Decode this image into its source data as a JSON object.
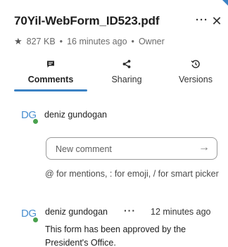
{
  "file": {
    "title": "70Yil-WebForm_ID523.pdf",
    "size": "827 KB",
    "modified": "16 minutes ago",
    "role": "Owner",
    "more_icon": "ellipsis-icon",
    "close_icon": "close-icon",
    "favorite_icon": "star-icon"
  },
  "tabs": [
    {
      "label": "Comments",
      "icon": "comment-icon",
      "active": true
    },
    {
      "label": "Sharing",
      "icon": "share-icon",
      "active": false
    },
    {
      "label": "Versions",
      "icon": "history-icon",
      "active": false
    }
  ],
  "current_user": {
    "initials": "DG",
    "name": "deniz gundogan"
  },
  "new_comment": {
    "placeholder": "New comment",
    "hint": "@ for mentions, : for emoji, / for smart picker",
    "submit_icon": "arrow-right-icon"
  },
  "comments": [
    {
      "initials": "DG",
      "author": "deniz gundogan",
      "time": "12 minutes ago",
      "text": "This form has been approved by the President's Office."
    }
  ],
  "colors": {
    "accent": "#3b82c4",
    "status_online": "#49a14e",
    "avatar_text": "#4a8fd0"
  }
}
